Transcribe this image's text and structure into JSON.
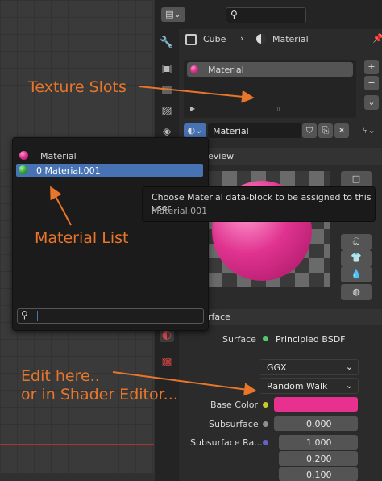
{
  "header": {
    "editor_icon": "editor-type-icon",
    "search_placeholder": ""
  },
  "breadcrumb": {
    "object": "Cube",
    "separator": "›",
    "material": "Material"
  },
  "slots": {
    "items": [
      "Material"
    ]
  },
  "material_selector": {
    "name": "Material"
  },
  "popup": {
    "items": [
      {
        "label": "Material",
        "selected": false
      },
      {
        "label": "0 Material.001",
        "selected": true
      }
    ],
    "search_value": ""
  },
  "tooltip": {
    "line1": "Choose Material data-block to be assigned to this user",
    "line2": "Material.001"
  },
  "preview": {
    "header": "eview"
  },
  "surface_panel": {
    "header": "rface",
    "surface_label": "Surface",
    "surface_value": "Principled BSDF",
    "distribution": "GGX",
    "subsurface_method": "Random Walk",
    "base_color_label": "Base Color",
    "subsurface_label": "Subsurface",
    "subsurface_value": "0.000",
    "subsurface_radius_label": "Subsurface Ra...",
    "radius_values": [
      "1.000",
      "0.200",
      "0.100"
    ]
  },
  "annotations": {
    "texture_slots": "Texture Slots",
    "material_list": "Material List",
    "edit_here_1": "Edit here..",
    "edit_here_2": "or in Shader Editor..."
  },
  "colors": {
    "base_color": "#e8308f",
    "annotation": "#e8762a",
    "selected_row": "#4772b3"
  }
}
